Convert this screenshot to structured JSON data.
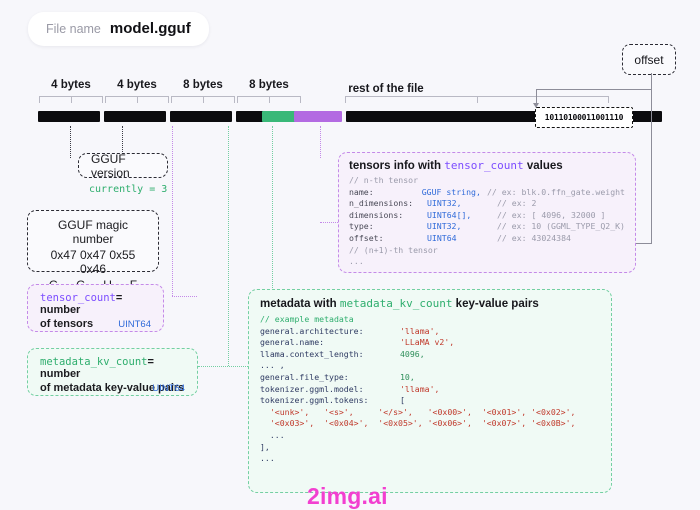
{
  "file": {
    "name_label": "File name",
    "name_value": "model.gguf"
  },
  "ruler": {
    "segments": [
      {
        "label": "4 bytes"
      },
      {
        "label": "4 bytes"
      },
      {
        "label": "8 bytes"
      },
      {
        "label": "8 bytes"
      },
      {
        "label": "rest of the file"
      }
    ]
  },
  "bar": {
    "binary_sample": "10110100011001110",
    "colors": {
      "black": "#0b0b0e",
      "green": "#39b878",
      "purple": "#b36ae2"
    }
  },
  "offset_bubble": {
    "label": "offset"
  },
  "version_box": {
    "title": "GGUF version",
    "note": "currently = 3"
  },
  "magic_box": {
    "title": "GGUF magic number",
    "hex": "0x47 0x47 0x55 0x46",
    "chars": [
      "G",
      "G",
      "U",
      "F"
    ]
  },
  "tensor_count_box": {
    "name": "tensor_count",
    "text": "= number",
    "line2": "of tensors",
    "type": "UINT64"
  },
  "metadata_kv_count_box": {
    "name": "metadata_kv_count",
    "text": "= number",
    "line2": "of metadata key-value pairs",
    "type": "UINT64"
  },
  "tensors_info_box": {
    "title_pre": "tensors info with ",
    "title_code": "tensor_count",
    "title_post": " values",
    "comment_top": "// n-th tensor",
    "rows": [
      {
        "field": "name:",
        "type": "GGUF string,",
        "comment": "// ex: blk.0.ffn_gate.weight"
      },
      {
        "field": "n_dimensions:",
        "type": "UINT32,",
        "comment": "// ex: 2"
      },
      {
        "field": "dimensions:",
        "type": "UINT64[],",
        "comment": "// ex: [ 4096, 32000 ]"
      },
      {
        "field": "type:",
        "type": "UINT32,",
        "comment": "// ex: 10 (GGML_TYPE_Q2_K)"
      },
      {
        "field": "offset:",
        "type": "UINT64",
        "comment": "// ex: 43024384"
      }
    ],
    "comment_mid": "// (n+1)-th tensor",
    "comment_end": "..."
  },
  "metadata_box": {
    "title_pre": "metadata with ",
    "title_code": "metadata_kv_count",
    "title_post": " key-value pairs",
    "comment_top": "// example metadata",
    "rows": [
      {
        "key": "general.architecture:",
        "value": "'llama',",
        "kind": "string"
      },
      {
        "key": "general.name:",
        "value": "'LLaMA v2',",
        "kind": "string"
      },
      {
        "key": "llama.context_length:",
        "value": "4096,",
        "kind": "number"
      },
      {
        "key": "... ,",
        "value": "",
        "kind": "plain"
      },
      {
        "key": "general.file_type:",
        "value": "10,",
        "kind": "number"
      },
      {
        "key": "tokenizer.ggml.model:",
        "value": "'llama',",
        "kind": "string"
      },
      {
        "key": "tokenizer.ggml.tokens:",
        "value": "[",
        "kind": "plain"
      }
    ],
    "tokens_line1": "  '<unk>',   '<s>',     '</s>',   '<0x00>',  '<0x01>', '<0x02>',",
    "tokens_line2": "  '<0x03>',  '<0x04>',  '<0x05>', '<0x06>',  '<0x07>', '<0x0B>',",
    "tokens_ellipsis": "  ...",
    "tokens_close": "],",
    "comment_end": "..."
  },
  "watermark": {
    "text": "2img.ai"
  }
}
